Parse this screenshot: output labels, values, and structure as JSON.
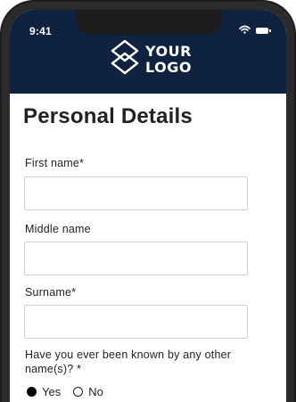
{
  "status_bar": {
    "time": "9:41"
  },
  "logo": {
    "line1": "YOUR",
    "line2": "LOGO"
  },
  "form": {
    "title": "Personal Details",
    "fields": [
      {
        "label": "First name*",
        "value": ""
      },
      {
        "label": "Middle name",
        "value": ""
      },
      {
        "label": "Surname*",
        "value": ""
      }
    ],
    "question": {
      "text": "Have you ever been known by any other name(s)? *",
      "options": [
        {
          "label": "Yes",
          "selected": true
        },
        {
          "label": "No",
          "selected": false
        }
      ]
    }
  },
  "colors": {
    "header_bg": "#0f223f",
    "frame": "#1c1c1e"
  }
}
